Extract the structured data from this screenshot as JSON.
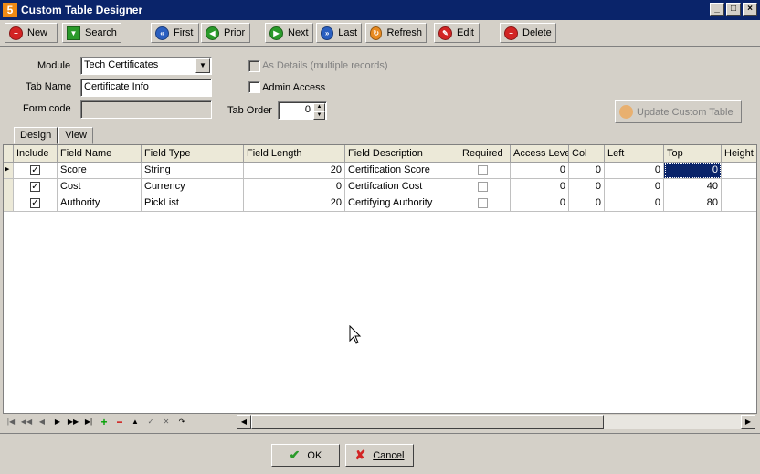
{
  "window": {
    "title": "Custom Table Designer",
    "app_icon_letter": "5"
  },
  "toolbar": [
    {
      "label": "New",
      "icon": "plus-circle-icon",
      "color": "#d22424"
    },
    {
      "label": "Search",
      "icon": "funnel-icon",
      "color": "#2a9a2a"
    },
    {
      "label": "First",
      "icon": "first-icon",
      "color": "#2a5fc0"
    },
    {
      "label": "Prior",
      "icon": "prior-icon",
      "color": "#2a9a2a"
    },
    {
      "label": "Next",
      "icon": "next-icon",
      "color": "#2a9a2a"
    },
    {
      "label": "Last",
      "icon": "last-icon",
      "color": "#2a5fc0"
    },
    {
      "label": "Refresh",
      "icon": "refresh-icon",
      "color": "#e88a20"
    },
    {
      "label": "Edit",
      "icon": "edit-icon",
      "color": "#d22424"
    },
    {
      "label": "Delete",
      "icon": "delete-icon",
      "color": "#d22424"
    }
  ],
  "form": {
    "module_label": "Module",
    "module_value": "Tech Certificates",
    "tab_name_label": "Tab Name",
    "tab_name_value": "Certificate Info",
    "form_code_label": "Form code",
    "form_code_value": "",
    "as_details_label": "As Details (multiple records)",
    "admin_access_label": "Admin Access",
    "tab_order_label": "Tab Order",
    "tab_order_value": "0",
    "update_button_label": "Update Custom Table"
  },
  "tabs": [
    "Design",
    "View"
  ],
  "grid": {
    "columns": [
      "Include",
      "Field Name",
      "Field Type",
      "Field Length",
      "Field Description",
      "Required",
      "Access Leve",
      "Col",
      "Left",
      "Top",
      "Height"
    ],
    "rows": [
      {
        "include": "✓",
        "name": "Score",
        "type": "String",
        "length": "20",
        "description": "Certification Score",
        "access": "0",
        "col": "0",
        "left": "0",
        "top": "0"
      },
      {
        "include": "✓",
        "name": "Cost",
        "type": "Currency",
        "length": "0",
        "description": "Certifcation Cost",
        "access": "0",
        "col": "0",
        "left": "0",
        "top": "40"
      },
      {
        "include": "✓",
        "name": "Authority",
        "type": "PickList",
        "length": "20",
        "description": "Certifying Authority",
        "access": "0",
        "col": "0",
        "left": "0",
        "top": "80"
      }
    ]
  },
  "footer": {
    "ok_label": "OK",
    "cancel_label": "Cancel"
  }
}
